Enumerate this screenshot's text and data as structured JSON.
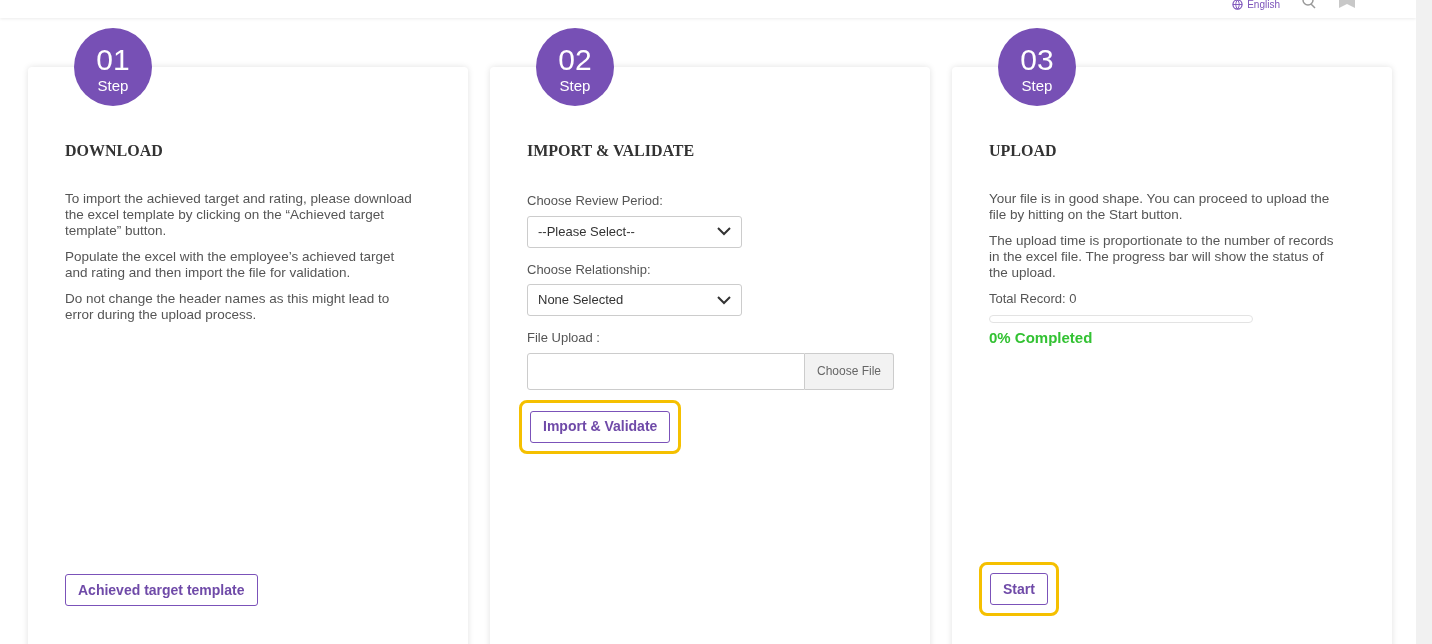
{
  "header": {
    "language": "English"
  },
  "steps": [
    {
      "number": "01",
      "step_label": "Step",
      "title": "DOWNLOAD",
      "content": [
        {
          "kind": "paragraph",
          "text": "To import the achieved target and rating, please download the excel template by clicking on the “Achieved target template” button."
        },
        {
          "kind": "paragraph",
          "text": "Populate the excel with the employee’s achieved target and rating and then import the file for validation."
        },
        {
          "kind": "paragraph",
          "text": "Do not change the header names as this might lead to error during the upload process."
        }
      ],
      "footer_button": {
        "label": "Achieved target template",
        "highlighted": false
      }
    },
    {
      "number": "02",
      "step_label": "Step",
      "title": "IMPORT & VALIDATE",
      "content": [
        {
          "kind": "select",
          "label": "Choose Review Period:",
          "value": "--Please Select--"
        },
        {
          "kind": "select",
          "label": "Choose Relationship:",
          "value": "None Selected"
        },
        {
          "kind": "file",
          "label": "File Upload :",
          "button": "Choose File"
        },
        {
          "kind": "button",
          "label": "Import & Validate",
          "highlighted": true
        }
      ]
    },
    {
      "number": "03",
      "step_label": "Step",
      "title": "UPLOAD",
      "content": [
        {
          "kind": "paragraph",
          "text": "Your file is in good shape. You can proceed to upload the file by hitting on the Start button."
        },
        {
          "kind": "paragraph",
          "text": "The upload time is proportionate to the number of records in the excel file. The progress bar will show the status of the upload."
        },
        {
          "kind": "record",
          "text": "Total Record: 0"
        },
        {
          "kind": "progress",
          "level": 0,
          "reading": "0% Completed"
        }
      ],
      "footer_button": {
        "label": "Start",
        "highlighted": true
      }
    }
  ]
}
